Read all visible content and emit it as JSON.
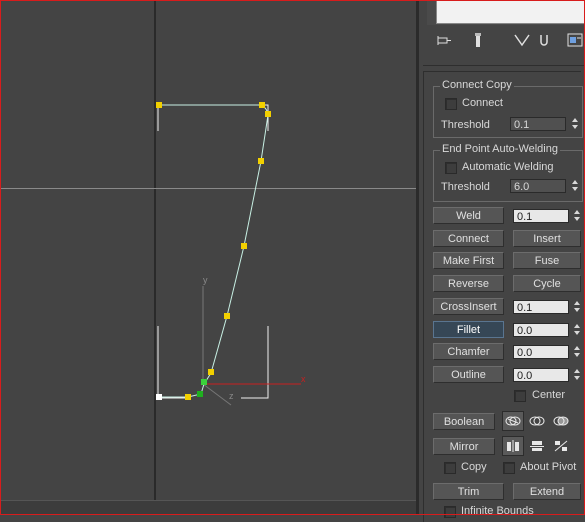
{
  "viewport": {
    "axis_labels": {
      "y": "y",
      "x": "x",
      "z": "z"
    }
  },
  "panel": {
    "toolbar_icons": [
      "pin-icon",
      "modifier-stack-icon",
      "show-end-result-icon",
      "make-unique-icon",
      "configure-modifier-sets-icon"
    ],
    "connect_copy": {
      "title": "Connect Copy",
      "connect_label": "Connect",
      "threshold_label": "Threshold",
      "threshold_value": "0.1"
    },
    "end_point_welding": {
      "title": "End Point Auto-Welding",
      "automatic_welding_label": "Automatic Welding",
      "threshold_label": "Threshold",
      "threshold_value": "6.0"
    },
    "ops": {
      "weld": "Weld",
      "weld_value": "0.1",
      "connect": "Connect",
      "insert": "Insert",
      "make_first": "Make First",
      "fuse": "Fuse",
      "reverse": "Reverse",
      "cycle": "Cycle",
      "crossinsert": "CrossInsert",
      "crossinsert_value": "0.1",
      "fillet": "Fillet",
      "fillet_value": "0.0",
      "chamfer": "Chamfer",
      "chamfer_value": "0.0",
      "outline": "Outline",
      "outline_value": "0.0",
      "center_label": "Center",
      "boolean": "Boolean",
      "mirror": "Mirror",
      "copy_label": "Copy",
      "about_pivot_label": "About Pivot",
      "trim": "Trim",
      "extend": "Extend",
      "infinite_bounds_label": "Infinite Bounds"
    }
  }
}
